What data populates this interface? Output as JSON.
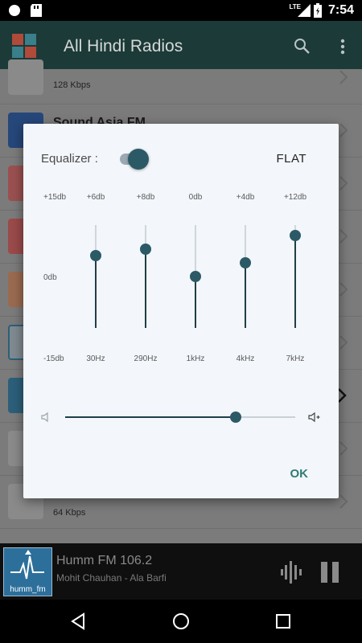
{
  "status_bar": {
    "network": "LTE",
    "time": "7:54"
  },
  "app_bar": {
    "title": "All Hindi Radios"
  },
  "list": {
    "rows": [
      {
        "title": "",
        "subtitle": "128 Kbps"
      },
      {
        "title": "Sound Asia FM",
        "subtitle": ""
      },
      {
        "title": "",
        "subtitle": ""
      },
      {
        "title": "",
        "subtitle": ""
      },
      {
        "title": "",
        "subtitle": ""
      },
      {
        "title": "",
        "subtitle": ""
      },
      {
        "title": "",
        "subtitle": ""
      },
      {
        "title": "",
        "subtitle": ""
      },
      {
        "title": "",
        "subtitle": "64 Kbps"
      }
    ]
  },
  "player": {
    "station": "Humm FM 106.2",
    "track": "Mohit Chauhan - Ala Barfi",
    "art_label": "humm_fm"
  },
  "dialog": {
    "equalizer_label": "Equalizer :",
    "equalizer_on": true,
    "preset": "FLAT",
    "scale_top": "+15db",
    "scale_mid": "0db",
    "scale_bottom": "-15db",
    "bands": [
      {
        "value": "+6db",
        "freq": "30Hz",
        "db": 6
      },
      {
        "value": "+8db",
        "freq": "290Hz",
        "db": 8
      },
      {
        "value": "0db",
        "freq": "1kHz",
        "db": 0
      },
      {
        "value": "+4db",
        "freq": "4kHz",
        "db": 4
      },
      {
        "value": "+12db",
        "freq": "7kHz",
        "db": 12
      }
    ],
    "volume_level": 0.74,
    "ok_label": "OK"
  },
  "colors": {
    "accent": "#2b5a66",
    "appbar": "#1c3a38",
    "ok": "#2e7d73"
  }
}
